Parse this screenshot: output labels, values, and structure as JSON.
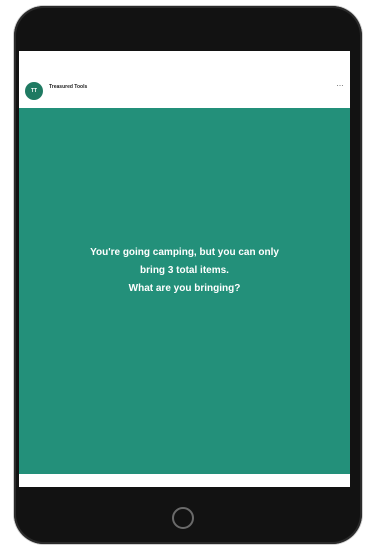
{
  "post": {
    "avatar_text": "TT",
    "account_name": "Treasured Tools",
    "more_symbol": "⋯",
    "prompt_lines": [
      "You're going camping, but you can only",
      "bring 3 total items.",
      "What are you bringing?"
    ]
  },
  "colors": {
    "background": "#23907a",
    "device": "#121212"
  },
  "icons": {
    "more": "more-options-icon",
    "home": "home-button"
  }
}
